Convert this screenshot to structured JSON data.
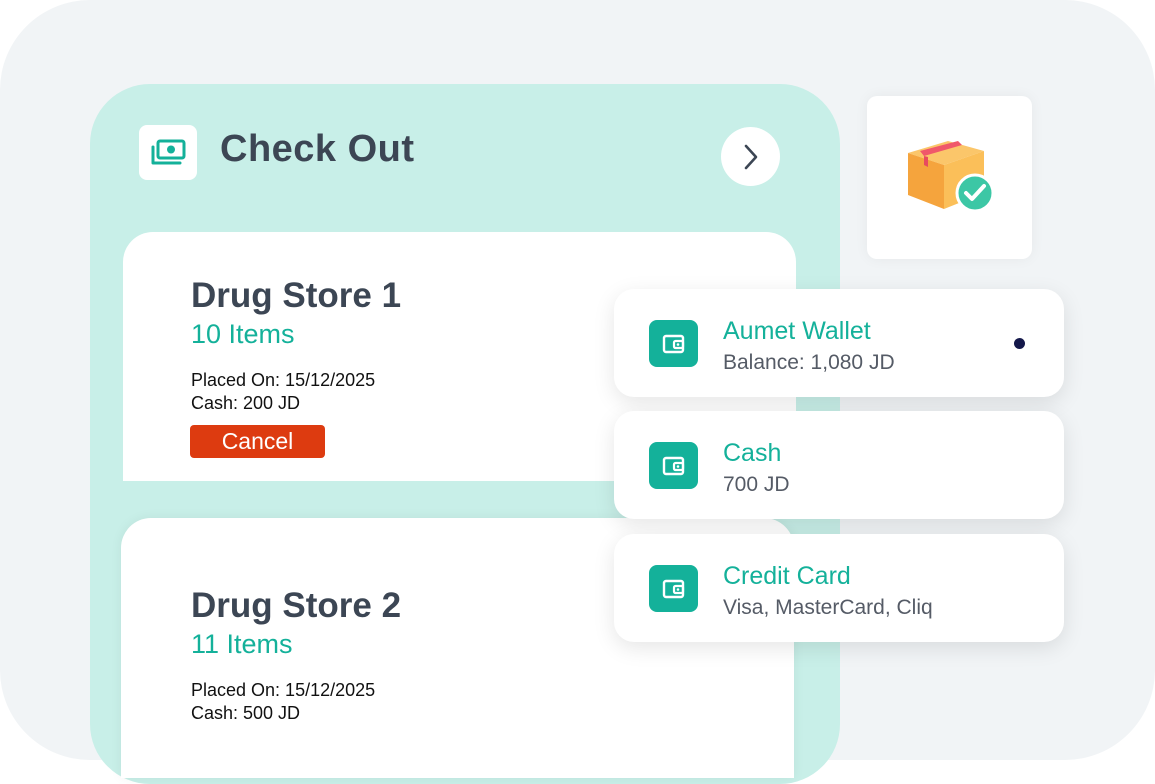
{
  "checkout": {
    "title": "Check Out"
  },
  "stores": [
    {
      "name": "Drug Store 1",
      "items": "10 Items",
      "placed_on": "Placed On: 15/12/2025",
      "cash": "Cash: 200 JD",
      "cancel_label": "Cancel"
    },
    {
      "name": "Drug Store 2",
      "items": "11 Items",
      "placed_on": "Placed On: 15/12/2025",
      "cash": "Cash: 500 JD"
    }
  ],
  "payment_methods": [
    {
      "name": "Aumet Wallet",
      "detail": "Balance: 1,080 JD",
      "selected": true
    },
    {
      "name": "Cash",
      "detail": "700 JD",
      "selected": false
    },
    {
      "name": "Credit Card",
      "detail": "Visa, MasterCard, Cliq",
      "selected": false
    }
  ],
  "icons": {
    "header": "money-icon",
    "next": "chevron-right-icon",
    "order": "package-check-icon",
    "payment": "wallet-icon"
  },
  "colors": {
    "accent": "#14b19a",
    "panel": "#c8efe8",
    "title": "#3c4654",
    "cancel": "#dd3b10",
    "selected_dot": "#14184a"
  }
}
